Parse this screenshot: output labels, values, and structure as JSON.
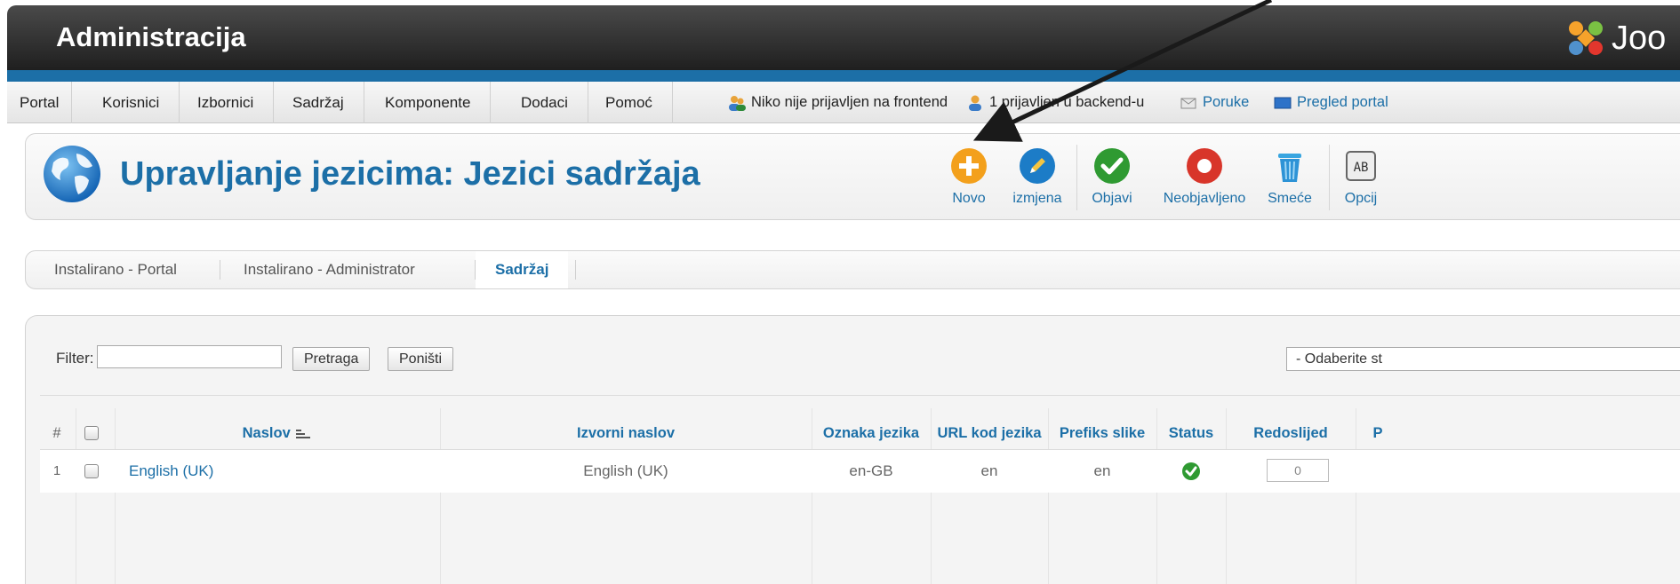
{
  "header": {
    "title": "Administracija",
    "logo_text": "Joo"
  },
  "menu": {
    "items": [
      "Portal",
      "Korisnici",
      "Izbornici",
      "Sadržaj",
      "Komponente",
      "Dodaci",
      "Pomoć"
    ],
    "status": {
      "frontend": "Niko nije prijavljen na frontend",
      "backend": "1 prijavljen u backend-u",
      "messages": "Poruke",
      "preview": "Pregled portal"
    }
  },
  "toolbar": {
    "page_title": "Upravljanje jezicima: Jezici sadržaja",
    "buttons": [
      "Novo",
      "izmjena",
      "Objavi",
      "Neobjavljeno",
      "Smeće",
      "Opcij"
    ]
  },
  "tabs": [
    "Instalirano - Portal",
    "Instalirano - Administrator",
    "Sadržaj"
  ],
  "filter": {
    "label": "Filter:",
    "value": "",
    "search_button": "Pretraga",
    "reset_button": "Poništi",
    "select_value": "- Odaberite st"
  },
  "table": {
    "headers": [
      "#",
      "Naslov",
      "Izvorni naslov",
      "Oznaka jezika",
      "URL kod jezika",
      "Prefiks slike",
      "Status",
      "Redoslijed",
      "P"
    ],
    "rows": [
      {
        "num": "1",
        "title": "English (UK)",
        "native": "English (UK)",
        "lang_code": "en-GB",
        "url_code": "en",
        "image_prefix": "en",
        "order": "0"
      }
    ]
  },
  "colors": {
    "accent": "#1c6fa7",
    "header": "#2b2b2b",
    "publish_green": "#2f9a32",
    "unpublish_red": "#d8352a",
    "new_orange": "#f3a01c"
  }
}
